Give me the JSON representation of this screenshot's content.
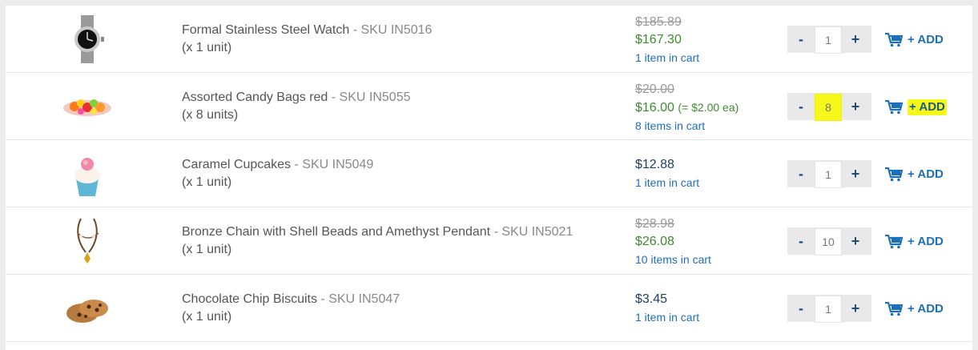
{
  "products": [
    {
      "name": "Formal Stainless Steel Watch",
      "sku": "- SKU IN5016",
      "units": "(x 1 unit)",
      "old_price": "$185.89",
      "price": "$167.30",
      "each": "",
      "in_cart": "1 item in cart",
      "qty": "1",
      "image_icon": "watch-image"
    },
    {
      "name": "Assorted Candy Bags red",
      "sku": "- SKU IN5055",
      "units": "(x 8 units)",
      "old_price": "$20.00",
      "price": "$16.00",
      "each": "(= $2.00 ea)",
      "in_cart": "8 items in cart",
      "qty": "8",
      "image_icon": "candy-image"
    },
    {
      "name": "Caramel Cupcakes",
      "sku": "- SKU IN5049",
      "units": "(x 1 unit)",
      "old_price": "",
      "price": "$12.88",
      "each": "",
      "in_cart": "1 item in cart",
      "qty": "1",
      "image_icon": "cupcake-image"
    },
    {
      "name": "Bronze Chain with Shell Beads and Amethyst Pendant",
      "sku": "- SKU IN5021",
      "units": "(x 1 unit)",
      "old_price": "$28.98",
      "price": "$26.08",
      "each": "",
      "in_cart": "10 items in cart",
      "qty": "10",
      "image_icon": "necklace-image"
    },
    {
      "name": "Chocolate Chip Biscuits",
      "sku": "- SKU IN5047",
      "units": "(x 1 unit)",
      "old_price": "",
      "price": "$3.45",
      "each": "",
      "in_cart": "1 item in cart",
      "qty": "1",
      "image_icon": "cookie-image"
    }
  ],
  "controls": {
    "minus_label": "-",
    "plus_label": "+",
    "add_label": "+ ADD",
    "cart_icon": "cart-icon"
  },
  "highlight_color": "#f6f81a",
  "accent_color": "#1d6fb8",
  "sale_color": "#3d8b2f"
}
